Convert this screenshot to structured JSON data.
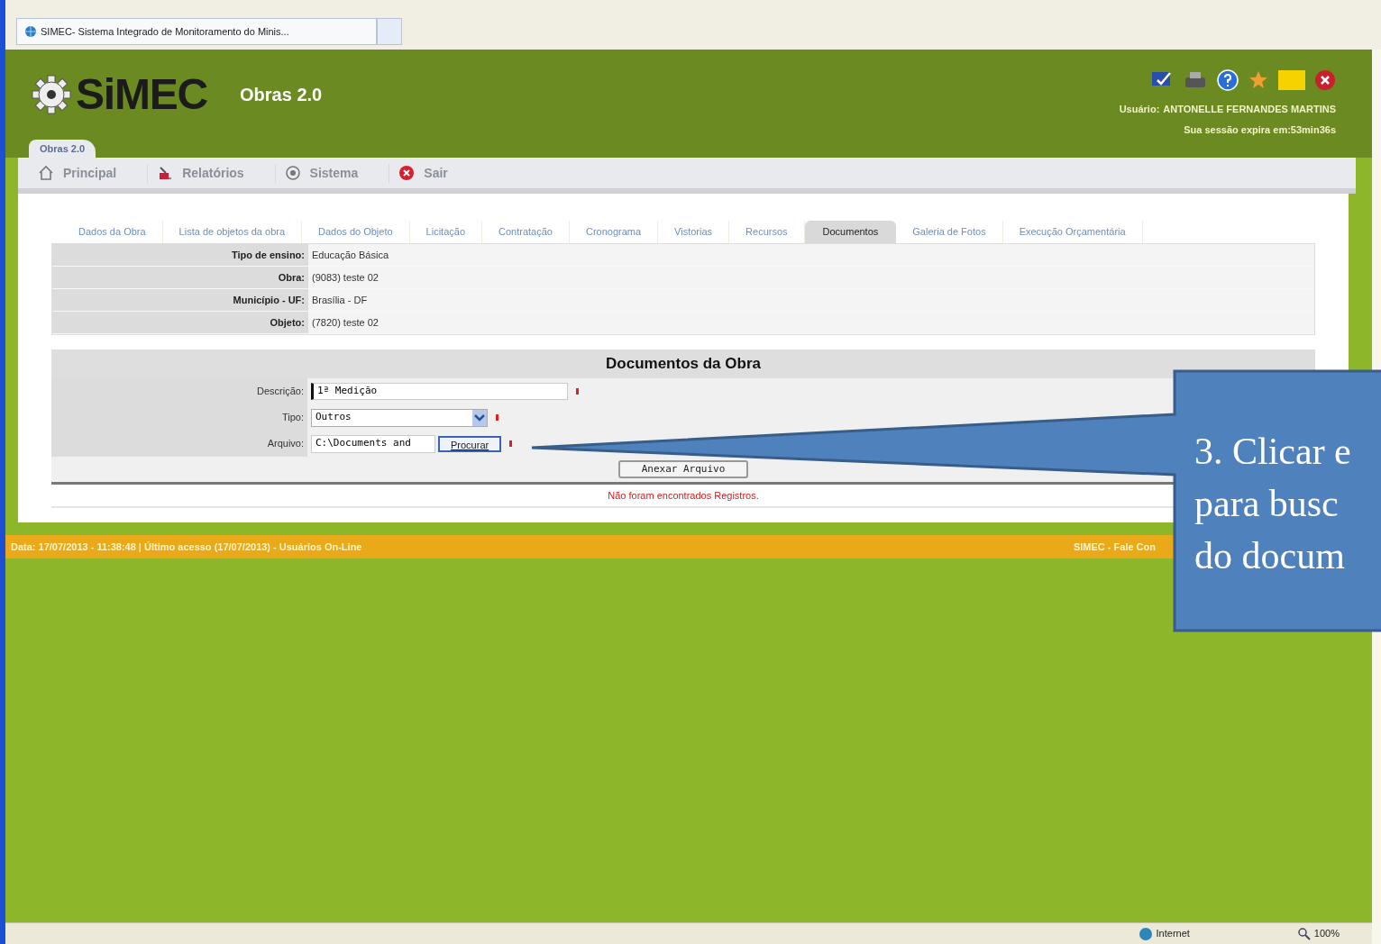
{
  "browser": {
    "tab_title": "SIMEC- Sistema Integrado de Monitoramento do Minis..."
  },
  "header": {
    "logo": "SiMEC",
    "module": "Obras 2.0",
    "user_label": "Usuário:",
    "user_name": "ANTONELLE FERNANDES MARTINS",
    "session": "Sua sessão expira em:53min36s",
    "module_tab": "Obras 2.0"
  },
  "menu": [
    {
      "label": "Principal"
    },
    {
      "label": "Relatórios"
    },
    {
      "label": "Sistema"
    },
    {
      "label": "Sair"
    }
  ],
  "tabs": [
    {
      "label": "Dados da Obra",
      "selected": false
    },
    {
      "label": "Lista de objetos da obra",
      "selected": false
    },
    {
      "label": "Dados do Objeto",
      "selected": false
    },
    {
      "label": "Licitação",
      "selected": false
    },
    {
      "label": "Contratação",
      "selected": false
    },
    {
      "label": "Cronograma",
      "selected": false
    },
    {
      "label": "Vistorias",
      "selected": false
    },
    {
      "label": "Recursos",
      "selected": false
    },
    {
      "label": "Documentos",
      "selected": true
    },
    {
      "label": "Galeria de Fotos",
      "selected": false
    },
    {
      "label": "Execução Orçamentária",
      "selected": false
    }
  ],
  "info": [
    {
      "label": "Tipo de ensino:",
      "value": "Educação Básica"
    },
    {
      "label": "Obra:",
      "value": "(9083) teste 02"
    },
    {
      "label": "Município - UF:",
      "value": "Brasília - DF"
    },
    {
      "label": "Objeto:",
      "value": "(7820) teste 02"
    }
  ],
  "form": {
    "title": "Documentos da Obra",
    "fields": [
      {
        "kind": "text",
        "label": "Descrição:",
        "value": "1ª Medição"
      },
      {
        "kind": "select",
        "label": "Tipo:",
        "value": "Outros"
      },
      {
        "kind": "file",
        "label": "Arquivo:",
        "value": "C:\\Documents and",
        "button": "Procurar"
      }
    ],
    "submit": "Anexar Arquivo",
    "empty_message": "Não foram encontrados Registros."
  },
  "footer": {
    "left": "Data: 17/07/2013 - 11:38:48 | Último acesso (17/07/2013) - Usuários On-Line",
    "right": "SIMEC - Fale Con"
  },
  "callout": {
    "lines": [
      "3. Clicar e",
      "para busc",
      "do docum"
    ]
  },
  "status_bar": {
    "zone": "Internet",
    "zoom": "100%"
  }
}
